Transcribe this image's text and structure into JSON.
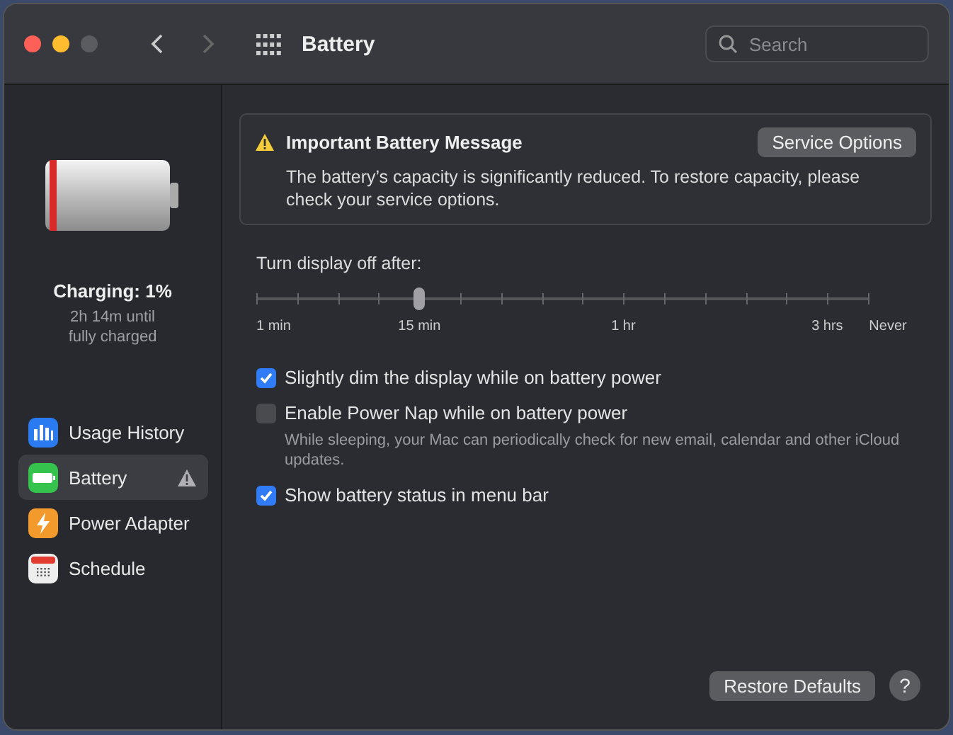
{
  "window": {
    "title": "Battery"
  },
  "search": {
    "placeholder": "Search"
  },
  "battery_status": {
    "title": "Charging: 1%",
    "detail": "2h 14m until fully charged"
  },
  "sidebar": {
    "items": [
      {
        "label": "Usage History",
        "kind": "usage",
        "selected": false,
        "warning": false
      },
      {
        "label": "Battery",
        "kind": "battery",
        "selected": true,
        "warning": true
      },
      {
        "label": "Power Adapter",
        "kind": "adapter",
        "selected": false,
        "warning": false
      },
      {
        "label": "Schedule",
        "kind": "schedule",
        "selected": false,
        "warning": false
      }
    ]
  },
  "alert": {
    "title": "Important Battery Message",
    "button": "Service Options",
    "message": "The battery’s capacity is significantly reduced. To restore capacity, please check your service options."
  },
  "display_off": {
    "label": "Turn display off after:",
    "level": 0.267,
    "labels": [
      "1 min",
      "15 min",
      "1 hr",
      "3 hrs",
      "Never"
    ]
  },
  "options": [
    {
      "label": "Slightly dim the display while on battery power",
      "checked": true
    },
    {
      "label": "Enable Power Nap while on battery power",
      "checked": false,
      "note": "While sleeping, your Mac can periodically check for new email, calendar and other iCloud updates."
    },
    {
      "label": "Show battery status in menu bar",
      "checked": true
    }
  ],
  "footer": {
    "button": "Restore Defaults",
    "help": "?"
  }
}
